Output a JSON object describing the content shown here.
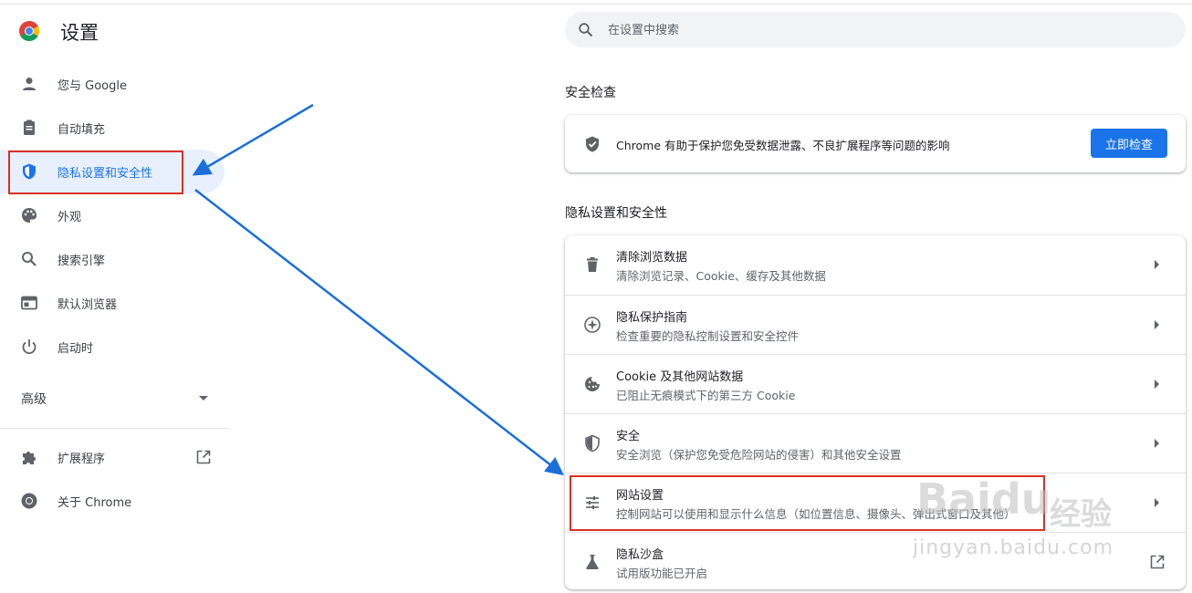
{
  "app": {
    "title": "设置"
  },
  "search": {
    "placeholder": "在设置中搜索"
  },
  "sidebar": {
    "items": [
      {
        "label": "您与 Google",
        "icon": "person-icon"
      },
      {
        "label": "自动填充",
        "icon": "clipboard-icon"
      },
      {
        "label": "隐私设置和安全性",
        "icon": "shield-icon",
        "active": true
      },
      {
        "label": "外观",
        "icon": "palette-icon"
      },
      {
        "label": "搜索引擎",
        "icon": "search-icon"
      },
      {
        "label": "默认浏览器",
        "icon": "browser-icon"
      },
      {
        "label": "启动时",
        "icon": "power-icon"
      }
    ],
    "advanced_label": "高级",
    "bottom_items": [
      {
        "label": "扩展程序",
        "icon": "puzzle-icon"
      },
      {
        "label": "关于 Chrome",
        "icon": "chrome-icon"
      }
    ]
  },
  "safety_check": {
    "section_title": "安全检查",
    "description": "Chrome 有助于保护您免受数据泄露、不良扩展程序等问题的影响",
    "button_label": "立即检查"
  },
  "privacy": {
    "section_title": "隐私设置和安全性",
    "rows": [
      {
        "title": "清除浏览数据",
        "subtitle": "清除浏览记录、Cookie、缓存及其他数据",
        "icon": "trash-icon"
      },
      {
        "title": "隐私保护指南",
        "subtitle": "检查重要的隐私控制设置和安全控件",
        "icon": "compass-icon"
      },
      {
        "title": "Cookie 及其他网站数据",
        "subtitle": "已阻止无痕模式下的第三方 Cookie",
        "icon": "cookie-icon"
      },
      {
        "title": "安全",
        "subtitle": "安全浏览（保护您免受危险网站的侵害）和其他安全设置",
        "icon": "shield-half-icon"
      },
      {
        "title": "网站设置",
        "subtitle": "控制网站可以使用和显示什么信息（如位置信息、摄像头、弹出式窗口及其他）",
        "icon": "sliders-icon"
      },
      {
        "title": "隐私沙盒",
        "subtitle": "试用版功能已开启",
        "icon": "flask-icon"
      }
    ]
  },
  "watermark": {
    "brand": "Baidu",
    "cn": "经验",
    "url": "jingyan.baidu.com"
  },
  "colors": {
    "accent": "#1a73e8",
    "highlight_box": "#d93025",
    "annotation_arrow": "#1a6fd9"
  }
}
